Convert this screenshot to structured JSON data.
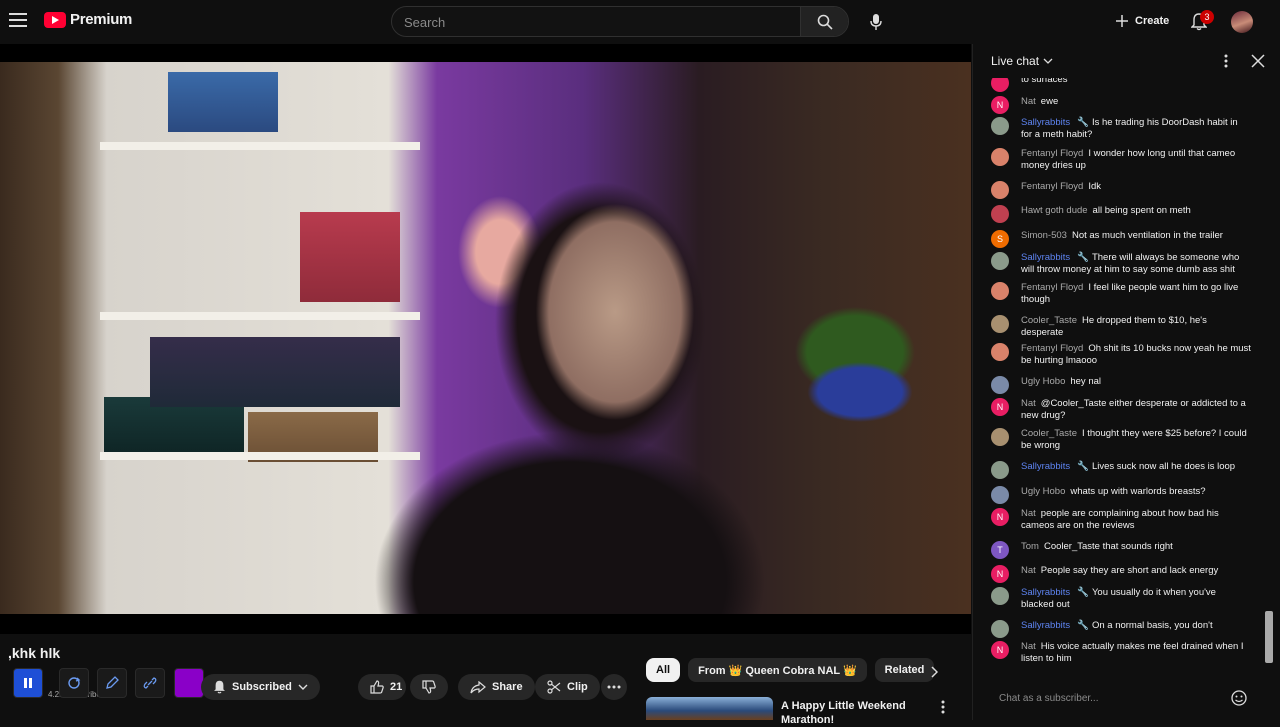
{
  "header": {
    "logo_text": "Premium",
    "search_placeholder": "Search",
    "create_label": "Create",
    "notification_count": "3"
  },
  "video": {
    "title": ",khk hlk",
    "subscribe_label": "Subscribed",
    "likes": "21",
    "share_label": "Share",
    "clip_label": "Clip",
    "subscriber_text": "4.2K subscribers"
  },
  "filters": {
    "all": "All",
    "from_channel": "From 👑 Queen Cobra NAL 👑",
    "related": "Related"
  },
  "related": {
    "title": "A Happy Little Weekend Marathon!"
  },
  "chat": {
    "header_label": "Live chat",
    "input_placeholder": "Chat as a subscriber...",
    "messages": [
      {
        "name": "",
        "text": "to surfaces",
        "initial": "",
        "color": "#e91e63",
        "mod": false
      },
      {
        "name": "Nat",
        "text": "ewe",
        "initial": "N",
        "color": "#e91e63",
        "mod": false
      },
      {
        "name": "Sallyrabbits",
        "text": "Is he trading his DoorDash habit in for a meth habit?",
        "initial": "",
        "color": "#8a9a8a",
        "mod": true
      },
      {
        "name": "Fentanyl Floyd",
        "text": "I wonder how long until that cameo money dries up",
        "initial": "",
        "color": "#d9826a",
        "mod": false
      },
      {
        "name": "Fentanyl Floyd",
        "text": "Idk",
        "initial": "",
        "color": "#d9826a",
        "mod": false
      },
      {
        "name": "Hawt goth dude",
        "text": "all being spent on meth",
        "initial": "",
        "color": "#c04050",
        "mod": false
      },
      {
        "name": "Simon-503",
        "text": "Not as much ventilation in the trailer",
        "initial": "S",
        "color": "#ef6c00",
        "mod": false
      },
      {
        "name": "Sallyrabbits",
        "text": "There will always be someone who will throw money at him to say some dumb ass shit",
        "initial": "",
        "color": "#8a9a8a",
        "mod": true
      },
      {
        "name": "Fentanyl Floyd",
        "text": "I feel like people want him to go live though",
        "initial": "",
        "color": "#d9826a",
        "mod": false
      },
      {
        "name": "Cooler_Taste",
        "text": "He dropped them to $10, he's desperate",
        "initial": "",
        "color": "#a89070",
        "mod": false
      },
      {
        "name": "Fentanyl Floyd",
        "text": "Oh shit its 10 bucks now yeah he must be hurting lmaooo",
        "initial": "",
        "color": "#d9826a",
        "mod": false
      },
      {
        "name": "Ugly Hobo",
        "text": "hey nal",
        "initial": "",
        "color": "#7a8aa8",
        "mod": false
      },
      {
        "name": "Nat",
        "text": "@Cooler_Taste either desperate or addicted to a new drug?",
        "initial": "N",
        "color": "#e91e63",
        "mod": false
      },
      {
        "name": "Cooler_Taste",
        "text": "I thought they were $25 before? I could be wrong",
        "initial": "",
        "color": "#a89070",
        "mod": false
      },
      {
        "name": "Sallyrabbits",
        "text": "Lives suck now all he does is loop",
        "initial": "",
        "color": "#8a9a8a",
        "mod": true
      },
      {
        "name": "Ugly Hobo",
        "text": "whats up with warlords breasts?",
        "initial": "",
        "color": "#7a8aa8",
        "mod": false
      },
      {
        "name": "Nat",
        "text": "people are complaining about how bad his cameos are on the reviews",
        "initial": "N",
        "color": "#e91e63",
        "mod": false
      },
      {
        "name": "Tom",
        "text": "Cooler_Taste that sounds right",
        "initial": "T",
        "color": "#7e57c2",
        "mod": false
      },
      {
        "name": "Nat",
        "text": "People say they are short and lack energy",
        "initial": "N",
        "color": "#e91e63",
        "mod": false
      },
      {
        "name": "Sallyrabbits",
        "text": "You usually do it when you've blacked out",
        "initial": "",
        "color": "#8a9a8a",
        "mod": true
      },
      {
        "name": "Sallyrabbits",
        "text": "On a normal basis, you don't",
        "initial": "",
        "color": "#8a9a8a",
        "mod": true
      },
      {
        "name": "Nat",
        "text": "His voice actually makes me feel drained when I listen to him",
        "initial": "N",
        "color": "#e91e63",
        "mod": false
      }
    ]
  }
}
